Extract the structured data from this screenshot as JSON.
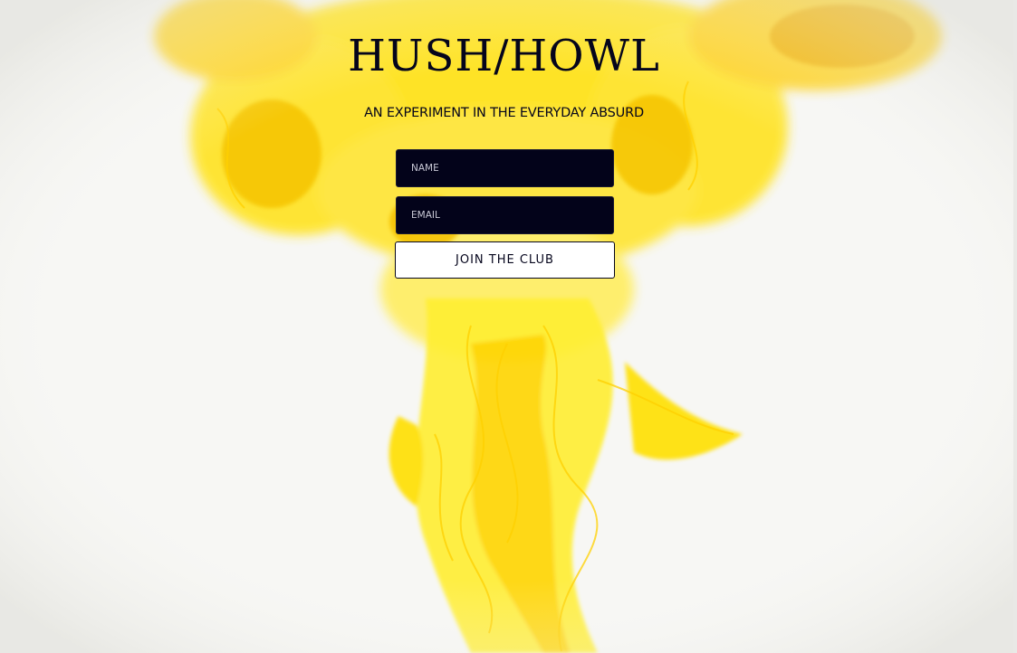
{
  "brand": {
    "title": "HUSH/HOWL",
    "tagline": "AN EXPERIMENT IN THE EVERYDAY ABSURD"
  },
  "form": {
    "name_placeholder": "NAME",
    "email_placeholder": "EMAIL",
    "submit_label": "JOIN THE CLUB"
  },
  "colors": {
    "ink": "#05051c",
    "field_bg": "#03031a",
    "smoke_yellow": "#ffe500",
    "background": "#f6f6f3"
  }
}
